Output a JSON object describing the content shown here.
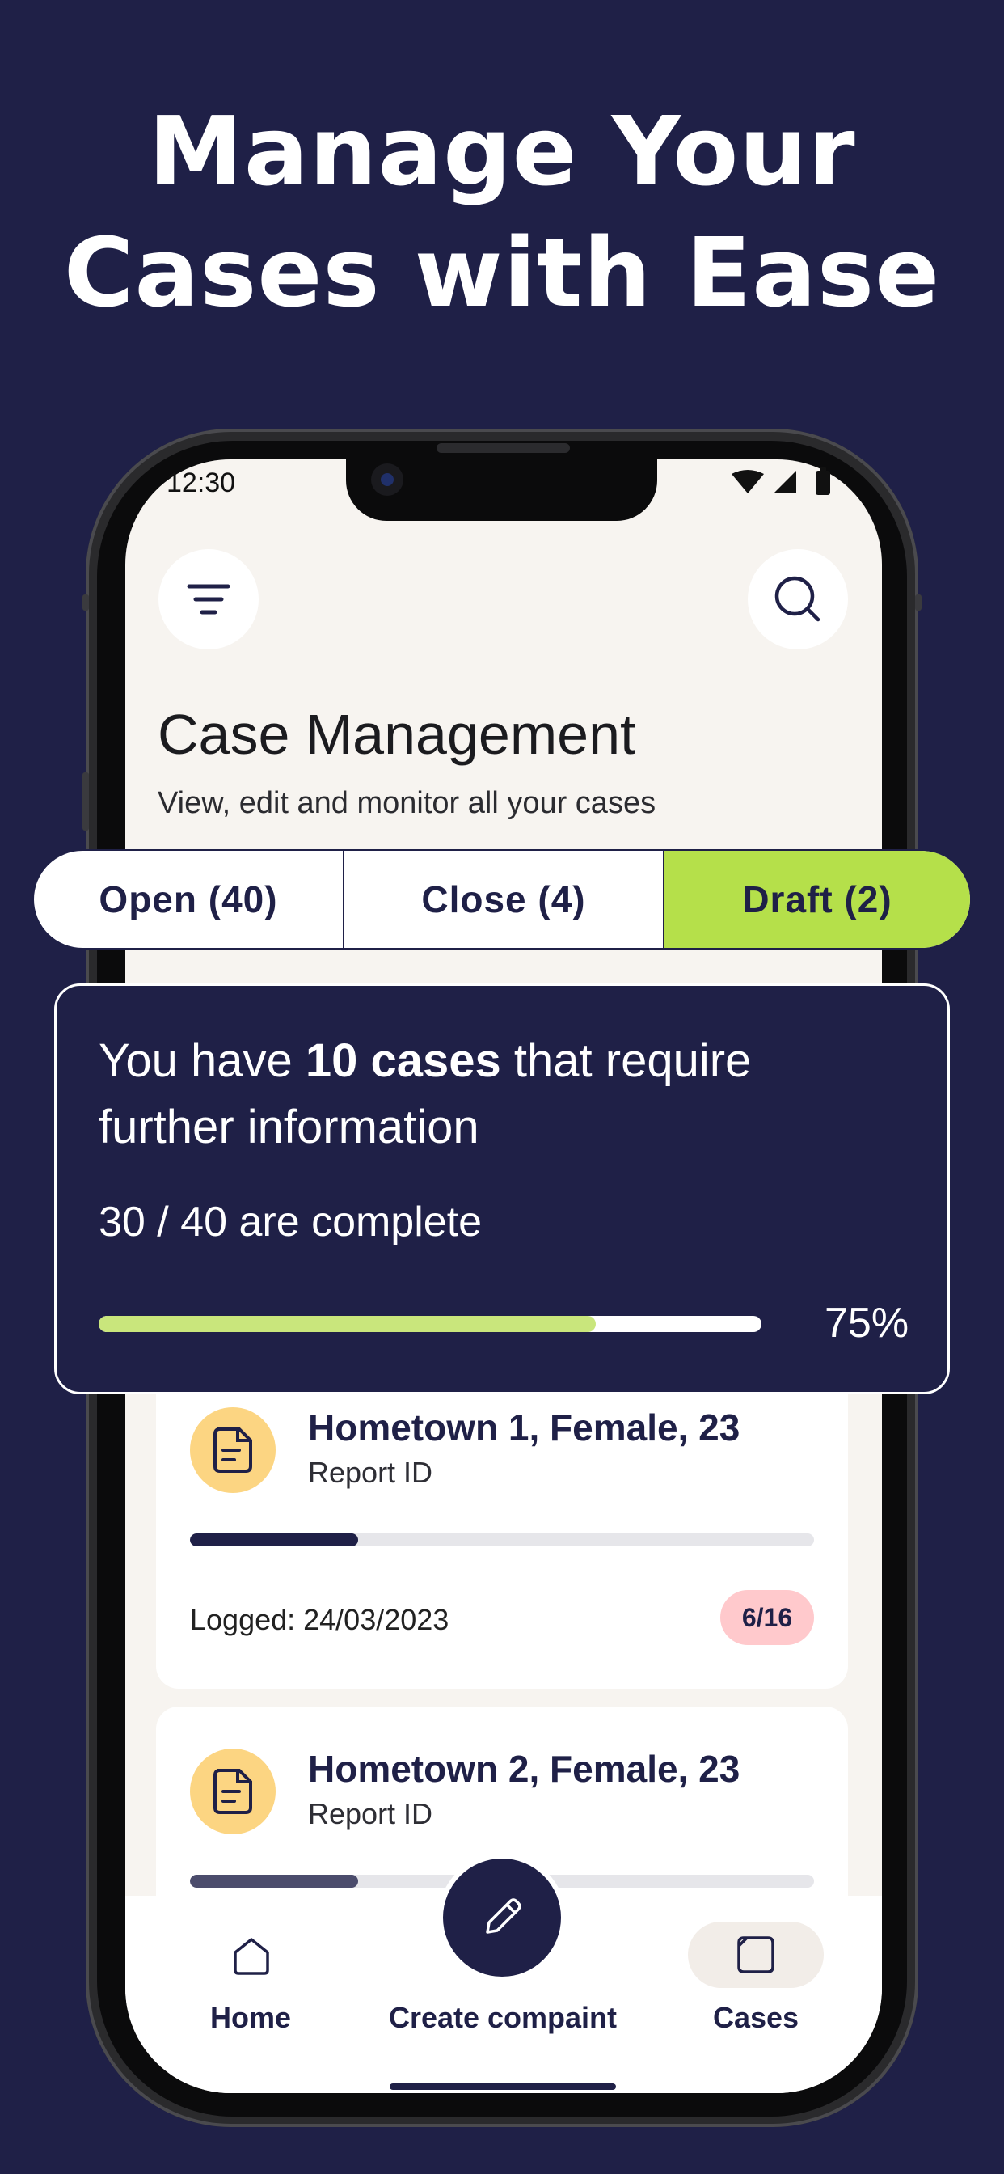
{
  "promo": {
    "headline_line1": "Manage Your",
    "headline_line2": "Cases with Ease"
  },
  "status_bar": {
    "time": "12:30",
    "icons": [
      "wifi-icon",
      "signal-icon",
      "battery-icon"
    ]
  },
  "header": {
    "filter_icon": "filter-icon",
    "search_icon": "search-icon",
    "title": "Case Management",
    "subtitle": "View, edit and monitor all your cases"
  },
  "tabs": [
    {
      "label": "Open (40)",
      "active": false
    },
    {
      "label": "Close (4)",
      "active": false
    },
    {
      "label": "Draft (2)",
      "active": true
    }
  ],
  "summary": {
    "message_prefix": "You have ",
    "message_bold": "10 cases",
    "message_suffix": " that require further information",
    "complete_text": "30 / 40 are complete",
    "progress_percent_label": "75%",
    "progress_fraction": 0.75
  },
  "cases": [
    {
      "title": "Hometown 1, Female, 23",
      "subtitle": "Report ID",
      "icon": "document-icon",
      "progress_fraction": 0.27,
      "logged": "Logged: 24/03/2023",
      "badge": "6/16"
    },
    {
      "title": "Hometown 2, Female, 23",
      "subtitle": "Report ID",
      "icon": "document-icon",
      "progress_fraction": 0.27
    }
  ],
  "bottom_nav": {
    "items": [
      {
        "label": "Home",
        "icon": "home-icon"
      },
      {
        "label": "Create compaint",
        "icon": "pencil-icon"
      },
      {
        "label": "Cases",
        "icon": "cases-icon",
        "active": true
      }
    ]
  },
  "colors": {
    "navy": "#1f2047",
    "accent_green": "#b5e04a",
    "progress_green": "#c9e67c",
    "case_icon_bg": "#fcd582",
    "badge_bg": "#ffc9cc",
    "screen_bg": "#f7f4f0"
  }
}
